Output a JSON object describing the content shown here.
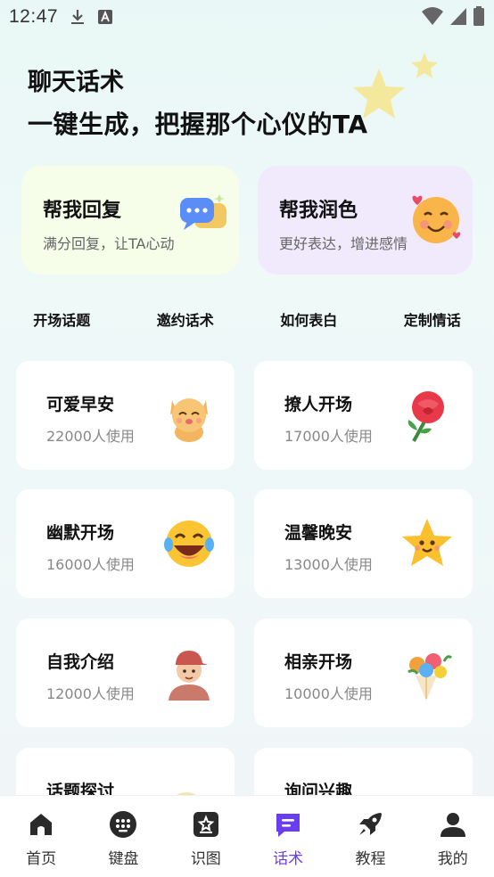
{
  "status_bar": {
    "time": "12:47"
  },
  "hero": {
    "title": "聊天话术",
    "subtitle": "一键生成，把握那个心仪的TA"
  },
  "features": [
    {
      "title": "帮我回复",
      "desc": "满分回复，让TA心动"
    },
    {
      "title": "帮我润色",
      "desc": "更好表达，增进感情"
    }
  ],
  "categories": [
    "开场话题",
    "邀约话术",
    "如何表白",
    "定制情话"
  ],
  "topics": [
    {
      "title": "可爱早安",
      "usage": "22000人使用",
      "icon": "cat-icon"
    },
    {
      "title": "撩人开场",
      "usage": "17000人使用",
      "icon": "rose-icon"
    },
    {
      "title": "幽默开场",
      "usage": "16000人使用",
      "icon": "laughing-face-icon"
    },
    {
      "title": "温馨晚安",
      "usage": "13000人使用",
      "icon": "star-face-icon"
    },
    {
      "title": "自我介绍",
      "usage": "12000人使用",
      "icon": "person-avatar-icon"
    },
    {
      "title": "相亲开场",
      "usage": "10000人使用",
      "icon": "bouquet-icon"
    },
    {
      "title": "话题探讨",
      "usage": "",
      "icon": "chat-bubble-icon"
    },
    {
      "title": "询问兴趣",
      "usage": "",
      "icon": "ticket-icon"
    }
  ],
  "nav": [
    {
      "label": "首页",
      "icon": "home-icon"
    },
    {
      "label": "键盘",
      "icon": "keyboard-icon"
    },
    {
      "label": "识图",
      "icon": "image-recognize-icon"
    },
    {
      "label": "话术",
      "icon": "chat-script-icon",
      "active": true
    },
    {
      "label": "教程",
      "icon": "rocket-icon"
    },
    {
      "label": "我的",
      "icon": "profile-icon"
    }
  ],
  "colors": {
    "accent": "#6a3df0",
    "reply_card": "#f6fde9",
    "polish_card": "#f1e9fc"
  }
}
